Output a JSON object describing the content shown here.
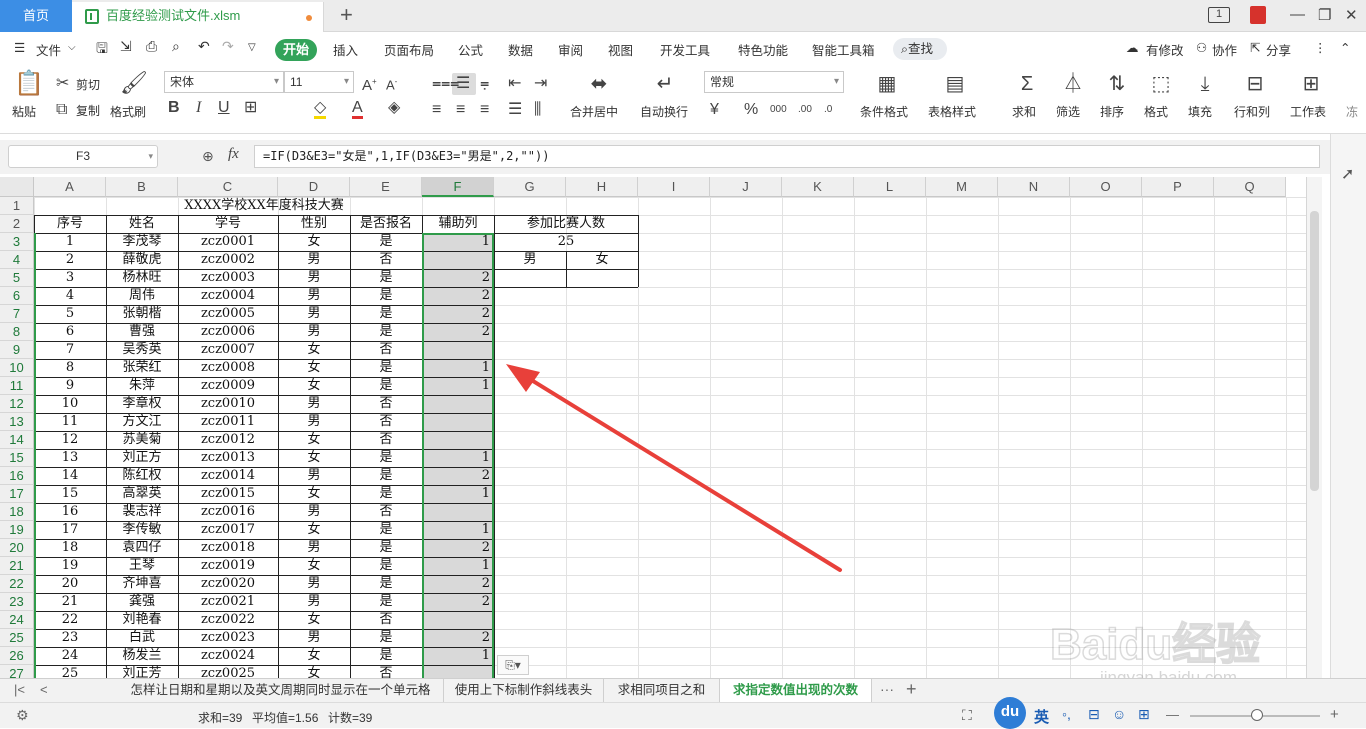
{
  "titlebar": {
    "home_tab": "首页",
    "file_tab": "百度经验测试文件.xlsm",
    "new_tab": "+",
    "page_indicator": "1"
  },
  "menu": {
    "file": "文件",
    "start": "开始",
    "items": [
      "插入",
      "页面布局",
      "公式",
      "数据",
      "审阅",
      "视图",
      "开发工具",
      "特色功能",
      "智能工具箱"
    ],
    "search": "查找",
    "has_edits": "有修改",
    "collab": "协作",
    "share": "分享"
  },
  "ribbon": {
    "paste": "粘贴",
    "cut": "剪切",
    "copy": "复制",
    "format_painter": "格式刷",
    "font_name": "宋体",
    "font_size": "11",
    "bold": "B",
    "italic": "I",
    "underline": "U",
    "merge_center": "合并居中",
    "wrap_text": "自动换行",
    "number_format": "常规",
    "cond_format": "条件格式",
    "table_style": "表格样式",
    "sum": "求和",
    "filter": "筛选",
    "sort": "排序",
    "format": "格式",
    "fill": "填充",
    "row_col": "行和列",
    "worksheet": "工作表",
    "more": "冻"
  },
  "formula_bar": {
    "name_box": "F3",
    "fx": "fx",
    "formula": "=IF(D3&E3=\"女是\",1,IF(D3&E3=\"男是\",2,\"\"))"
  },
  "grid": {
    "columns": [
      "A",
      "B",
      "C",
      "D",
      "E",
      "F",
      "G",
      "H",
      "I",
      "J",
      "K",
      "L",
      "M",
      "N",
      "O",
      "P",
      "Q"
    ],
    "selected_column": "F",
    "row_numbers": [
      "1",
      "2",
      "3",
      "4",
      "5",
      "6",
      "7",
      "8",
      "9",
      "10",
      "11",
      "12",
      "13",
      "14",
      "15",
      "16",
      "17",
      "18",
      "19",
      "20",
      "21",
      "22",
      "23",
      "24",
      "25",
      "26",
      "27"
    ],
    "title": "XXXX学校XX年度科技大赛",
    "headers": [
      "序号",
      "姓名",
      "学号",
      "性别",
      "是否报名",
      "辅助列"
    ],
    "rows": [
      [
        "1",
        "李茂琴",
        "zcz0001",
        "女",
        "是",
        "1"
      ],
      [
        "2",
        "薛敬虎",
        "zcz0002",
        "男",
        "否",
        ""
      ],
      [
        "3",
        "杨林旺",
        "zcz0003",
        "男",
        "是",
        "2"
      ],
      [
        "4",
        "周伟",
        "zcz0004",
        "男",
        "是",
        "2"
      ],
      [
        "5",
        "张朝楷",
        "zcz0005",
        "男",
        "是",
        "2"
      ],
      [
        "6",
        "曹强",
        "zcz0006",
        "男",
        "是",
        "2"
      ],
      [
        "7",
        "吴秀英",
        "zcz0007",
        "女",
        "否",
        ""
      ],
      [
        "8",
        "张荣红",
        "zcz0008",
        "女",
        "是",
        "1"
      ],
      [
        "9",
        "朱萍",
        "zcz0009",
        "女",
        "是",
        "1"
      ],
      [
        "10",
        "李章权",
        "zcz0010",
        "男",
        "否",
        ""
      ],
      [
        "11",
        "方文江",
        "zcz0011",
        "男",
        "否",
        ""
      ],
      [
        "12",
        "苏美菊",
        "zcz0012",
        "女",
        "否",
        ""
      ],
      [
        "13",
        "刘正方",
        "zcz0013",
        "女",
        "是",
        "1"
      ],
      [
        "14",
        "陈红权",
        "zcz0014",
        "男",
        "是",
        "2"
      ],
      [
        "15",
        "高翠英",
        "zcz0015",
        "女",
        "是",
        "1"
      ],
      [
        "16",
        "裴志祥",
        "zcz0016",
        "男",
        "否",
        ""
      ],
      [
        "17",
        "李传敏",
        "zcz0017",
        "女",
        "是",
        "1"
      ],
      [
        "18",
        "袁四仔",
        "zcz0018",
        "男",
        "是",
        "2"
      ],
      [
        "19",
        "王琴",
        "zcz0019",
        "女",
        "是",
        "1"
      ],
      [
        "20",
        "齐坤喜",
        "zcz0020",
        "男",
        "是",
        "2"
      ],
      [
        "21",
        "龚强",
        "zcz0021",
        "男",
        "是",
        "2"
      ],
      [
        "22",
        "刘艳春",
        "zcz0022",
        "女",
        "否",
        ""
      ],
      [
        "23",
        "白武",
        "zcz0023",
        "男",
        "是",
        "2"
      ],
      [
        "24",
        "杨发兰",
        "zcz0024",
        "女",
        "是",
        "1"
      ],
      [
        "25",
        "刘正芳",
        "zcz0025",
        "女",
        "否",
        ""
      ]
    ],
    "side_table": {
      "title": "参加比赛人数",
      "total": "25",
      "male": "男",
      "female": "女"
    }
  },
  "sheet_tabs": [
    "怎样让日期和星期以及英文周期同时显示在一个单元格",
    "使用上下标制作斜线表头",
    "求相同项目之和",
    "求指定数值出现的次数"
  ],
  "active_sheet": "求指定数值出现的次数",
  "status": {
    "sum": "求和=39",
    "avg": "平均值=1.56",
    "count": "计数=39"
  },
  "watermark": {
    "brand": "Baidu经验",
    "url": "jingyan.baidu.com"
  },
  "ime": {
    "label": "英"
  },
  "colors": {
    "accent_green": "#2f9b4a",
    "home_blue": "#3c8ee5",
    "arrow_red": "#e8403a"
  }
}
